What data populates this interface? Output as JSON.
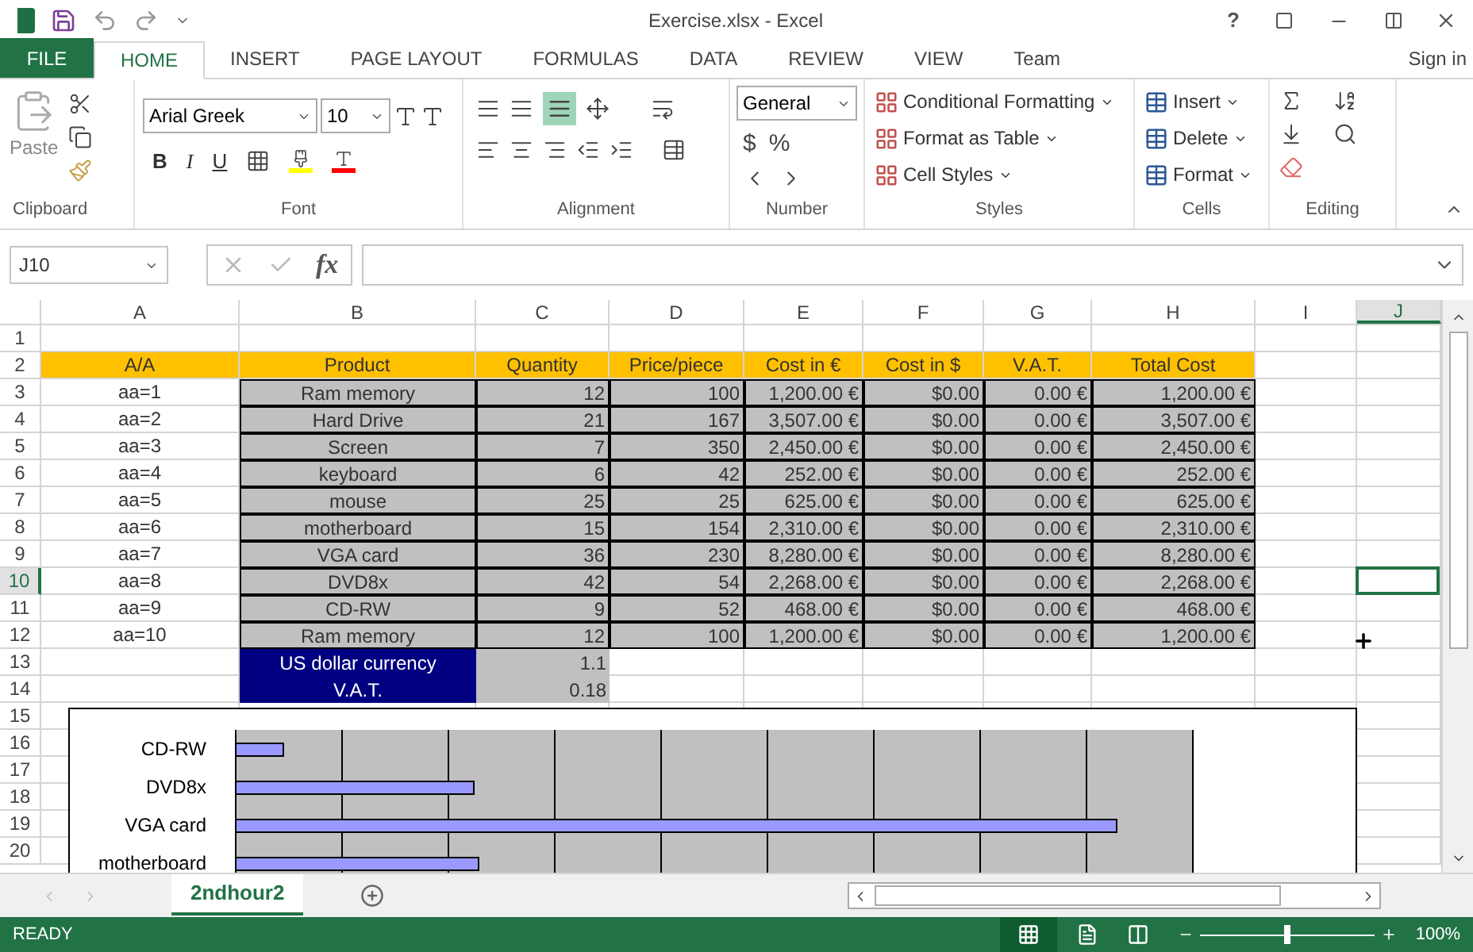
{
  "title_bar": {
    "title": "Exercise.xlsx - Excel",
    "help": "?"
  },
  "tabs": [
    {
      "label": "FILE",
      "kind": "file",
      "selected": false
    },
    {
      "label": "HOME",
      "kind": "tab",
      "selected": true
    },
    {
      "label": "INSERT",
      "kind": "tab",
      "selected": false
    },
    {
      "label": "PAGE LAYOUT",
      "kind": "tab",
      "selected": false
    },
    {
      "label": "FORMULAS",
      "kind": "tab",
      "selected": false
    },
    {
      "label": "DATA",
      "kind": "tab",
      "selected": false
    },
    {
      "label": "REVIEW",
      "kind": "tab",
      "selected": false
    },
    {
      "label": "VIEW",
      "kind": "tab",
      "selected": false
    },
    {
      "label": "Team",
      "kind": "tab",
      "selected": false
    }
  ],
  "sign_in": "Sign in",
  "ribbon": {
    "paste": "Paste",
    "font_name": "Arial Greek",
    "font_size": "10",
    "font_buttons": [
      "B",
      "I",
      "U"
    ],
    "number_format": "General",
    "number_buttons": [
      "$",
      "%"
    ],
    "styles": [
      "Conditional Formatting",
      "Format as Table",
      "Cell Styles"
    ],
    "cells": [
      "Insert",
      "Delete",
      "Format"
    ],
    "groups": [
      "Clipboard",
      "Font",
      "Alignment",
      "Number",
      "Styles",
      "Cells",
      "Editing"
    ]
  },
  "formula_bar": {
    "name_box": "J10",
    "function_label": "fx"
  },
  "sheet": {
    "columns": [
      {
        "label": "A",
        "selected": false
      },
      {
        "label": "B",
        "selected": false
      },
      {
        "label": "C",
        "selected": false
      },
      {
        "label": "D",
        "selected": false
      },
      {
        "label": "E",
        "selected": false
      },
      {
        "label": "F",
        "selected": false
      },
      {
        "label": "G",
        "selected": false
      },
      {
        "label": "H",
        "selected": false
      },
      {
        "label": "I",
        "selected": false
      },
      {
        "label": "J",
        "selected": true
      }
    ],
    "rows": [
      {
        "number": "1",
        "kind": "blank",
        "selected": false
      },
      {
        "number": "2",
        "kind": "header",
        "selected": false,
        "cells": [
          "A/A",
          "Product",
          "Quantity",
          "Price/piece",
          "Cost in €",
          "Cost in $",
          "V.A.T.",
          "Total Cost"
        ]
      },
      {
        "number": "3",
        "kind": "data",
        "selected": false,
        "cells": [
          "aa=1",
          "Ram memory",
          "12",
          "100",
          "1,200.00 €",
          "$0.00",
          "0.00 €",
          "1,200.00 €"
        ]
      },
      {
        "number": "4",
        "kind": "data",
        "selected": false,
        "cells": [
          "aa=2",
          "Hard Drive",
          "21",
          "167",
          "3,507.00 €",
          "$0.00",
          "0.00 €",
          "3,507.00 €"
        ]
      },
      {
        "number": "5",
        "kind": "data",
        "selected": false,
        "cells": [
          "aa=3",
          "Screen",
          "7",
          "350",
          "2,450.00 €",
          "$0.00",
          "0.00 €",
          "2,450.00 €"
        ]
      },
      {
        "number": "6",
        "kind": "data",
        "selected": false,
        "cells": [
          "aa=4",
          "keyboard",
          "6",
          "42",
          "252.00 €",
          "$0.00",
          "0.00 €",
          "252.00 €"
        ]
      },
      {
        "number": "7",
        "kind": "data",
        "selected": false,
        "cells": [
          "aa=5",
          "mouse",
          "25",
          "25",
          "625.00 €",
          "$0.00",
          "0.00 €",
          "625.00 €"
        ]
      },
      {
        "number": "8",
        "kind": "data",
        "selected": false,
        "cells": [
          "aa=6",
          "motherboard",
          "15",
          "154",
          "2,310.00 €",
          "$0.00",
          "0.00 €",
          "2,310.00 €"
        ]
      },
      {
        "number": "9",
        "kind": "data",
        "selected": false,
        "cells": [
          "aa=7",
          "VGA card",
          "36",
          "230",
          "8,280.00 €",
          "$0.00",
          "0.00 €",
          "8,280.00 €"
        ]
      },
      {
        "number": "10",
        "kind": "data",
        "selected": true,
        "cells": [
          "aa=8",
          "DVD8x",
          "42",
          "54",
          "2,268.00 €",
          "$0.00",
          "0.00 €",
          "2,268.00 €"
        ]
      },
      {
        "number": "11",
        "kind": "data",
        "selected": false,
        "cells": [
          "aa=9",
          "CD-RW",
          "9",
          "52",
          "468.00 €",
          "$0.00",
          "0.00 €",
          "468.00 €"
        ]
      },
      {
        "number": "12",
        "kind": "data",
        "selected": false,
        "cells": [
          "aa=10",
          "Ram memory",
          "12",
          "100",
          "1,200.00 €",
          "$0.00",
          "0.00 €",
          "1,200.00 €"
        ]
      },
      {
        "number": "13",
        "kind": "param",
        "selected": false,
        "cells": [
          "US dollar currency",
          "1.1"
        ]
      },
      {
        "number": "14",
        "kind": "param",
        "selected": false,
        "cells": [
          "V.A.T.",
          "0.18"
        ]
      },
      {
        "number": "15",
        "kind": "blank",
        "selected": false
      },
      {
        "number": "16",
        "kind": "blank",
        "selected": false
      },
      {
        "number": "17",
        "kind": "blank",
        "selected": false
      },
      {
        "number": "18",
        "kind": "blank",
        "selected": false
      },
      {
        "number": "19",
        "kind": "blank",
        "selected": false
      },
      {
        "number": "20",
        "kind": "blank",
        "selected": false
      }
    ]
  },
  "chart": {
    "bars": [
      {
        "label": "CD-RW",
        "level": 0.051
      },
      {
        "label": "DVD8x",
        "level": 0.25
      },
      {
        "label": "VGA card",
        "level": 0.92
      },
      {
        "label": "motherboard",
        "level": 0.255
      }
    ]
  },
  "sheet_tabs": [
    {
      "label": "2ndhour2",
      "selected": true
    }
  ],
  "status_bar": {
    "status": "READY",
    "zoom": "100%",
    "zoom_slider": {
      "level": 0.5
    }
  }
}
